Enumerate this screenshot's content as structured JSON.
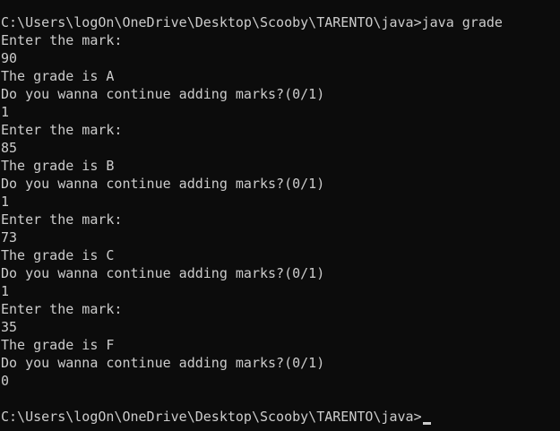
{
  "terminal": {
    "lines": [
      "C:\\Users\\logOn\\OneDrive\\Desktop\\Scooby\\TARENTO\\java>java grade",
      "Enter the mark:",
      "90",
      "The grade is A",
      "Do you wanna continue adding marks?(0/1)",
      "1",
      "Enter the mark:",
      "85",
      "The grade is B",
      "Do you wanna continue adding marks?(0/1)",
      "1",
      "Enter the mark:",
      "73",
      "The grade is C",
      "Do you wanna continue adding marks?(0/1)",
      "1",
      "Enter the mark:",
      "35",
      "The grade is F",
      "Do you wanna continue adding marks?(0/1)",
      "0",
      "",
      "C:\\Users\\logOn\\OneDrive\\Desktop\\Scooby\\TARENTO\\java>"
    ],
    "colors": {
      "background": "#0c0c0c",
      "text": "#cccccc"
    }
  }
}
